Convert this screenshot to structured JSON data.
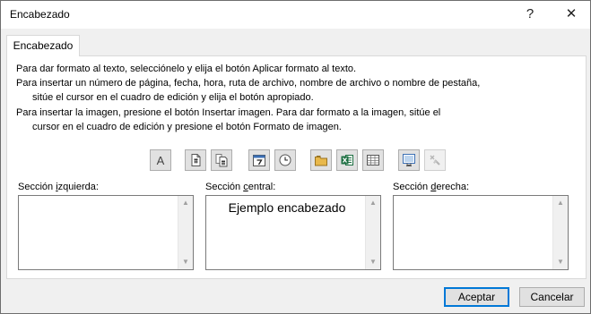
{
  "window": {
    "title": "Encabezado",
    "help_glyph": "?",
    "close_glyph": "✕"
  },
  "tab": {
    "label": "Encabezado"
  },
  "instructions": [
    "Para dar formato al texto, selecciónelo y elija el botón Aplicar formato al texto.",
    "Para insertar un número de página, fecha, hora, ruta de archivo, nombre de archivo o nombre de pestaña,",
    "sitúe el cursor en el cuadro de edición y elija el botón apropiado.",
    "Para insertar la imagen, presione el botón Insertar imagen. Para dar formato a la imagen, sitúe el",
    "cursor en el cuadro de edición y presione el botón Formato de imagen."
  ],
  "toolbar": {
    "format_text_glyph": "A",
    "buttons": [
      "format-text-icon",
      "page-number-icon",
      "page-count-icon",
      "date-icon",
      "time-icon",
      "file-path-icon",
      "file-name-icon",
      "sheet-name-icon",
      "insert-picture-icon",
      "format-picture-icon"
    ]
  },
  "sections": {
    "left": {
      "pre": "Sección ",
      "accel": "i",
      "post": "zquierda:",
      "value": ""
    },
    "center": {
      "pre": "Sección ",
      "accel": "c",
      "post": "entral:",
      "value": "Ejemplo encabezado"
    },
    "right": {
      "pre": "Sección ",
      "accel": "d",
      "post": "erecha:",
      "value": ""
    }
  },
  "buttons": {
    "accept": "Aceptar",
    "cancel": "Cancelar"
  },
  "colors": {
    "accent_border": "#0078d7",
    "excel_green": "#1d6f42",
    "panel_bg": "#ffffff",
    "dialog_bg": "#f0f0f0"
  }
}
